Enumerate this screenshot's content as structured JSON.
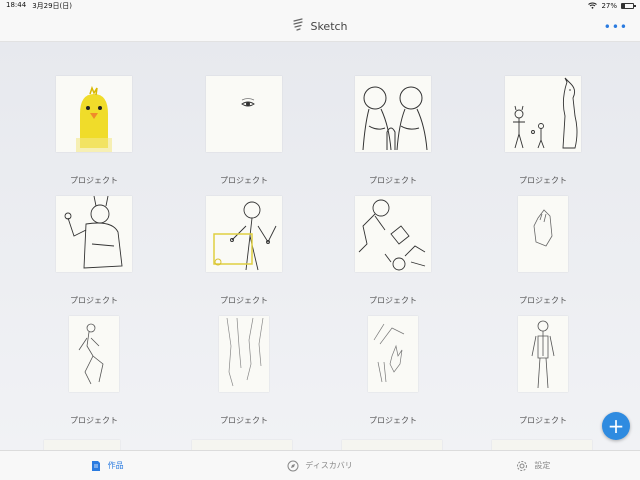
{
  "status_bar": {
    "time": "18:44",
    "date": "3月29日(日)",
    "battery": "27%",
    "battery_level": 0.27
  },
  "nav": {
    "title": "Sketch",
    "logo_icon": "sketch-logo-icon",
    "more_icon": "ellipsis-icon",
    "more_label": "•••"
  },
  "projects": [
    {
      "label": "プロジェクト",
      "thumb": "chick"
    },
    {
      "label": "プロジェクト",
      "thumb": "eye"
    },
    {
      "label": "プロジェクト",
      "thumb": "figures"
    },
    {
      "label": "プロジェクト",
      "thumb": "characters"
    },
    {
      "label": "プロジェクト",
      "thumb": "pose-arm"
    },
    {
      "label": "プロジェクト",
      "thumb": "pose-box"
    },
    {
      "label": "プロジェクト",
      "thumb": "tumbling"
    },
    {
      "label": "プロジェクト",
      "thumb": "hand"
    },
    {
      "label": "プロジェクト",
      "thumb": "sitting"
    },
    {
      "label": "プロジェクト",
      "thumb": "legs"
    },
    {
      "label": "プロジェクト",
      "thumb": "hands-peace"
    },
    {
      "label": "プロジェクト",
      "thumb": "standing"
    }
  ],
  "fab": {
    "label": "+",
    "icon": "plus-icon"
  },
  "tabs": [
    {
      "label": "作品",
      "icon": "document-icon",
      "active": true
    },
    {
      "label": "ディスカバリ",
      "icon": "compass-icon",
      "active": false
    },
    {
      "label": "設定",
      "icon": "gear-icon",
      "active": false
    }
  ],
  "colors": {
    "accent": "#2f8be0",
    "chick": "#f0dc2a"
  }
}
